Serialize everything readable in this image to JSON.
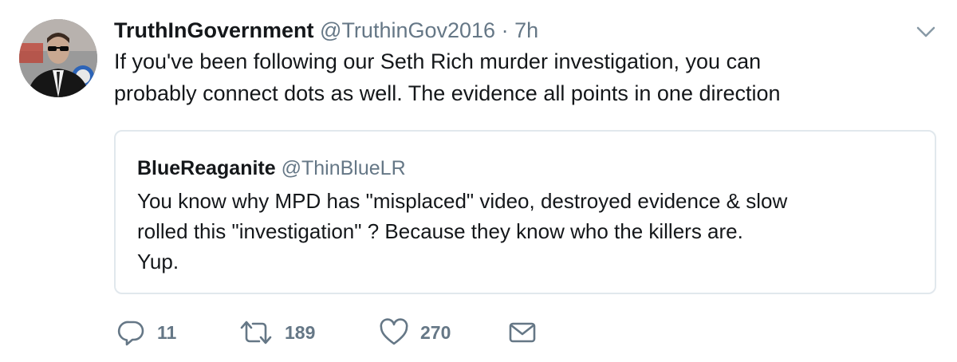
{
  "tweet": {
    "display_name": "TruthInGovernment",
    "screen_name": "@TruthinGov2016",
    "separator": "·",
    "timestamp": "7h",
    "text_lines": [
      "If you've been following our Seth Rich murder investigation, you can",
      "probably connect dots as well. The evidence all points in one direction"
    ],
    "menu_icon": "chevron-down-icon",
    "avatar_icon": "avatar"
  },
  "quoted_tweet": {
    "display_name": "BlueReaganite",
    "screen_name": "@ThinBlueLR",
    "text_lines": [
      "You know why MPD has \"misplaced\" video, destroyed evidence & slow",
      "rolled this \"investigation\" ? Because they know who the killers are.",
      "Yup."
    ]
  },
  "actions": {
    "reply": {
      "icon": "reply-icon",
      "count": "11"
    },
    "retweet": {
      "icon": "retweet-icon",
      "count": "189"
    },
    "like": {
      "icon": "heart-icon",
      "count": "270"
    },
    "message": {
      "icon": "envelope-icon"
    }
  },
  "colors": {
    "text": "#14171a",
    "secondary": "#657786",
    "border": "#e1e8ed"
  }
}
